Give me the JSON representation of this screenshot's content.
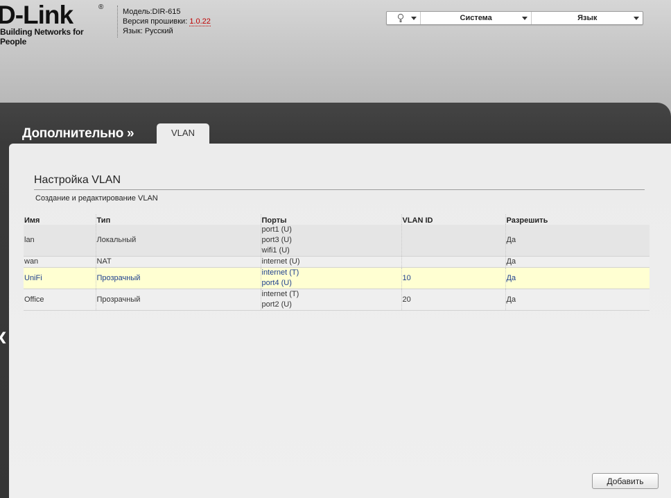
{
  "header": {
    "logo_main": "D-Link",
    "logo_reg": "®",
    "logo_tagline": "Building Networks for People",
    "model_label": "Модель:",
    "model_value": "DIR-615",
    "firmware_label": "Версия прошивки:",
    "firmware_value": "1.0.22",
    "language_label": "Язык:",
    "language_value": "Русский"
  },
  "topbar": {
    "system_label": "Система",
    "language_menu_label": "Язык"
  },
  "nav": {
    "section_title": "Дополнительно »",
    "active_tab": "VLAN"
  },
  "page": {
    "title": "Настройка VLAN",
    "subtitle": "Создание и редактирование VLAN"
  },
  "table": {
    "headers": [
      "Имя",
      "Тип",
      "Порты",
      "VLAN ID",
      "Разрешить"
    ],
    "rows": [
      {
        "name": "lan",
        "type": "Локальный",
        "ports": [
          "port1 (U)",
          "port3 (U)",
          "wifi1 (U)"
        ],
        "vlan_id": "",
        "allow": "Да"
      },
      {
        "name": "wan",
        "type": "NAT",
        "ports": [
          "internet (U)"
        ],
        "vlan_id": "",
        "allow": "Да"
      },
      {
        "name": "UniFi",
        "type": "Прозрачный",
        "ports": [
          "internet (T)",
          "port4 (U)"
        ],
        "vlan_id": "10",
        "allow": "Да"
      },
      {
        "name": "Office",
        "type": "Прозрачный",
        "ports": [
          "internet (T)",
          "port2 (U)"
        ],
        "vlan_id": "20",
        "allow": "Да"
      }
    ]
  },
  "actions": {
    "add_label": "Добавить"
  },
  "colors": {
    "highlight_row_bg": "#ffffd2",
    "highlight_row_text": "#1e3f8e",
    "firmware_text": "#c00000",
    "dark_band": "#3a3a3a"
  },
  "icons": {
    "hint": "lightbulb-icon",
    "dropdown": "chevron-down-icon",
    "side_arrow": "chevron-left-icon"
  }
}
